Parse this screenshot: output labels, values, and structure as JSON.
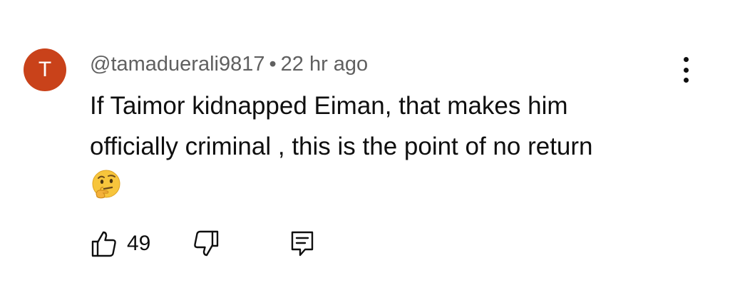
{
  "comment": {
    "avatar_letter": "T",
    "avatar_color": "#c9421a",
    "author": "@tamaduerali9817",
    "separator": "•",
    "time": "22 hr ago",
    "text_lines": [
      "If Taimor kidnapped Eiman, that makes him",
      "officially criminal , this is the point of no return"
    ],
    "emoji": "thinking-face-icon",
    "like_count": "49"
  },
  "actions": {
    "like_icon": "thumbs-up-icon",
    "dislike_icon": "thumbs-down-icon",
    "reply_icon": "reply-comment-icon",
    "more_icon": "more-vertical-icon"
  }
}
